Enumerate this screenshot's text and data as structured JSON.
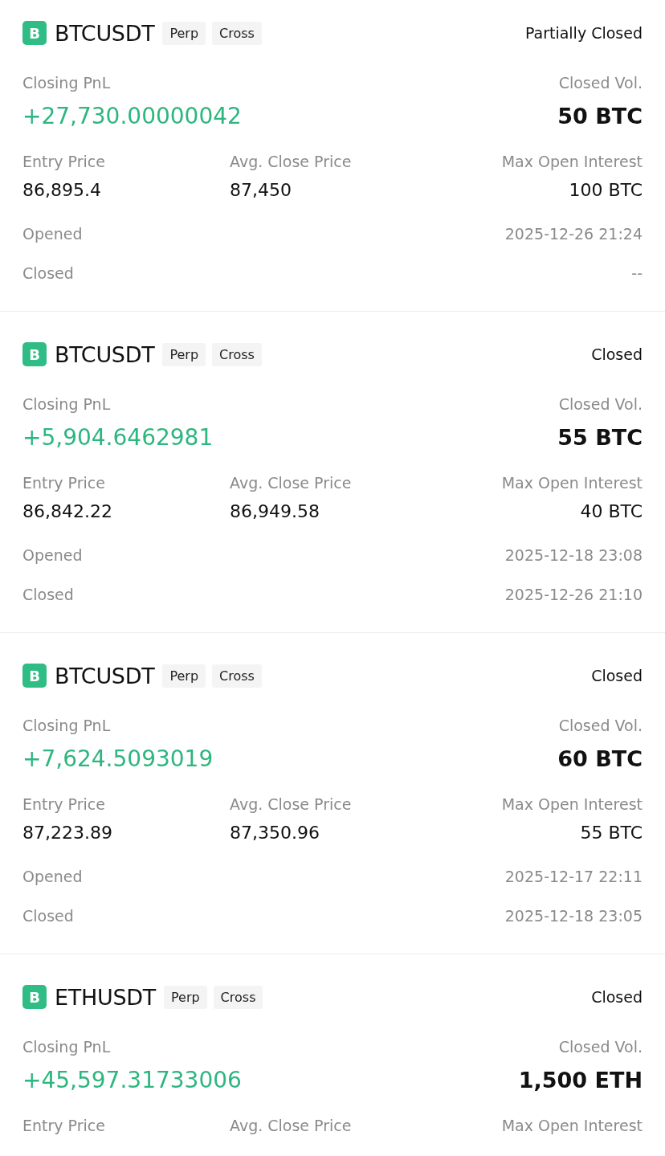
{
  "positions": [
    {
      "icon_letter": "B",
      "symbol": "BTCUSDT",
      "tags": [
        "Perp",
        "Cross"
      ],
      "status": "Partially Closed",
      "pnl_label": "Closing PnL",
      "pnl": "+27,730.00000042",
      "vol_label": "Closed Vol.",
      "vol": "50 BTC",
      "details": [
        {
          "label": "Entry Price",
          "value": "86,895.4"
        },
        {
          "label": "Avg. Close Price",
          "value": "87,450"
        },
        {
          "label": "Max Open Interest",
          "value": "100 BTC"
        }
      ],
      "times": [
        {
          "label": "Opened",
          "value": "2025-12-26 21:24"
        },
        {
          "label": "Closed",
          "value": "--"
        }
      ]
    },
    {
      "icon_letter": "B",
      "symbol": "BTCUSDT",
      "tags": [
        "Perp",
        "Cross"
      ],
      "status": "Closed",
      "pnl_label": "Closing PnL",
      "pnl": "+5,904.6462981",
      "vol_label": "Closed Vol.",
      "vol": "55 BTC",
      "details": [
        {
          "label": "Entry Price",
          "value": "86,842.22"
        },
        {
          "label": "Avg. Close Price",
          "value": "86,949.58"
        },
        {
          "label": "Max Open Interest",
          "value": "40 BTC"
        }
      ],
      "times": [
        {
          "label": "Opened",
          "value": "2025-12-18 23:08"
        },
        {
          "label": "Closed",
          "value": "2025-12-26 21:10"
        }
      ]
    },
    {
      "icon_letter": "B",
      "symbol": "BTCUSDT",
      "tags": [
        "Perp",
        "Cross"
      ],
      "status": "Closed",
      "pnl_label": "Closing PnL",
      "pnl": "+7,624.5093019",
      "vol_label": "Closed Vol.",
      "vol": "60 BTC",
      "details": [
        {
          "label": "Entry Price",
          "value": "87,223.89"
        },
        {
          "label": "Avg. Close Price",
          "value": "87,350.96"
        },
        {
          "label": "Max Open Interest",
          "value": "55 BTC"
        }
      ],
      "times": [
        {
          "label": "Opened",
          "value": "2025-12-17 22:11"
        },
        {
          "label": "Closed",
          "value": "2025-12-18 23:05"
        }
      ]
    },
    {
      "icon_letter": "B",
      "symbol": "ETHUSDT",
      "tags": [
        "Perp",
        "Cross"
      ],
      "status": "Closed",
      "pnl_label": "Closing PnL",
      "pnl": "+45,597.31733006",
      "vol_label": "Closed Vol.",
      "vol": "1,500 ETH",
      "details": [
        {
          "label": "Entry Price"
        },
        {
          "label": "Avg. Close Price"
        },
        {
          "label": "Max Open Interest"
        }
      ]
    }
  ]
}
